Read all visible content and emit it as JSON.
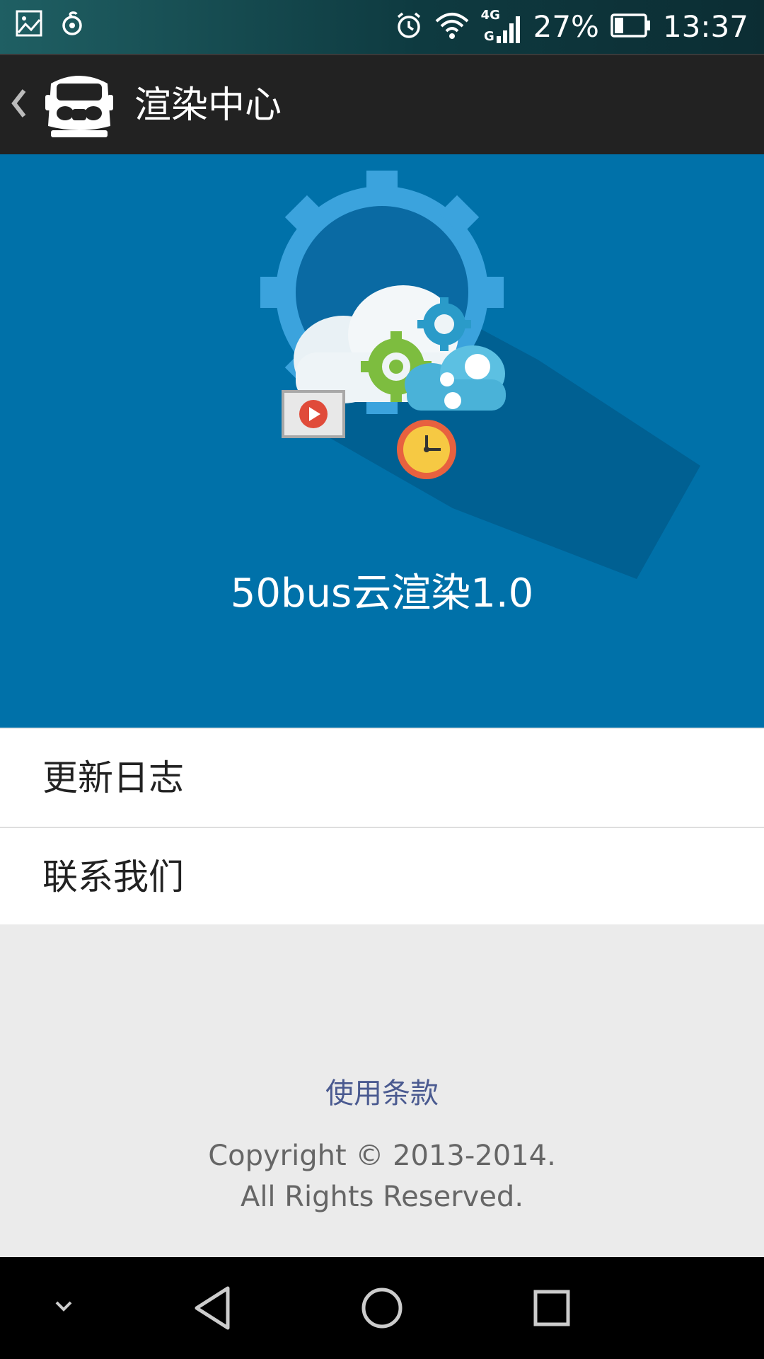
{
  "status_bar": {
    "battery": "27%",
    "time": "13:37",
    "network": "4G",
    "icons": [
      "gallery-icon",
      "sync-icon",
      "alarm-icon",
      "wifi-icon",
      "signal-icon",
      "battery-icon"
    ]
  },
  "app_bar": {
    "title": "渲染中心",
    "icons": [
      "back-chevron-icon",
      "bus-logo-icon"
    ]
  },
  "hero": {
    "title": "50bus云渲染1.0",
    "background": "#0071a9"
  },
  "menu": {
    "items": [
      {
        "label": "更新日志"
      },
      {
        "label": "联系我们"
      }
    ]
  },
  "footer": {
    "terms": "使用条款",
    "copyright_line1": "Copyright © 2013-2014.",
    "copyright_line2": "All Rights Reserved."
  },
  "nav_bar": {
    "icons": [
      "collapse-icon",
      "back-icon",
      "home-icon",
      "recents-icon"
    ]
  }
}
